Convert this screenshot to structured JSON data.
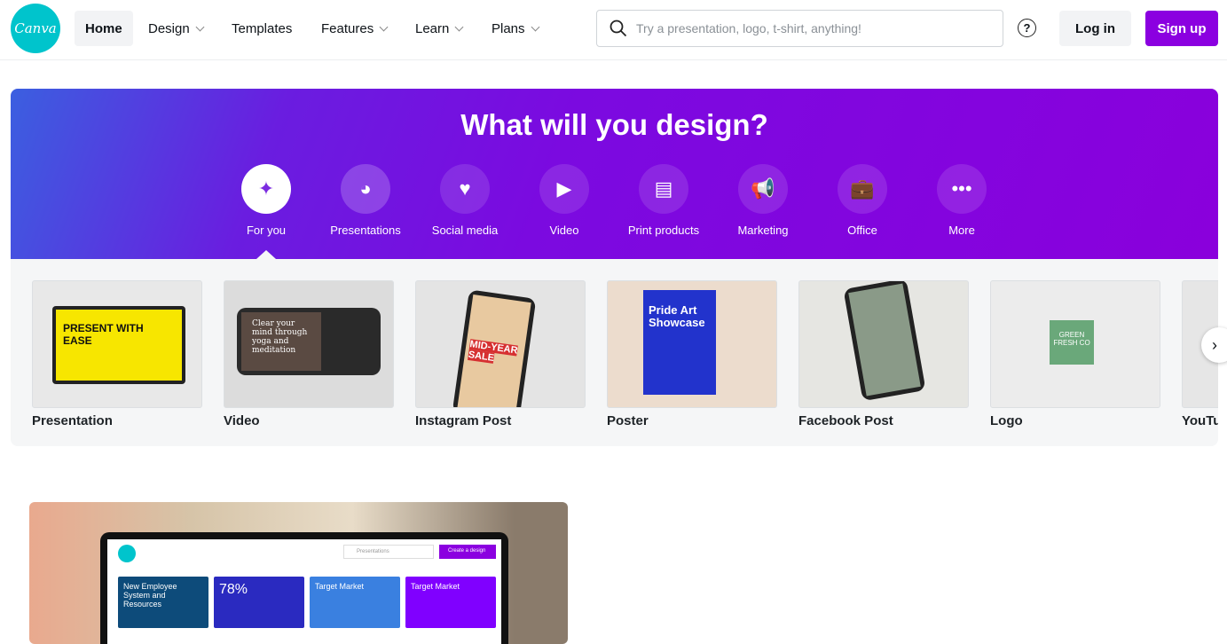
{
  "header": {
    "logo": "Canva",
    "nav": [
      {
        "label": "Home",
        "active": true
      },
      {
        "label": "Design",
        "dropdown": true
      },
      {
        "label": "Templates"
      },
      {
        "label": "Features",
        "dropdown": true
      },
      {
        "label": "Learn",
        "dropdown": true
      },
      {
        "label": "Plans",
        "dropdown": true
      }
    ],
    "search_placeholder": "Try a presentation, logo, t-shirt, anything!",
    "help": "?",
    "login": "Log in",
    "signup": "Sign up"
  },
  "colors": {
    "brand_teal": "#00c4cc",
    "accent_purple": "#8b00e0"
  },
  "banner": {
    "title": "What will you design?",
    "categories": [
      {
        "label": "For you",
        "icon": "sparkle-icon",
        "selected": true
      },
      {
        "label": "Presentations",
        "icon": "presentation-icon"
      },
      {
        "label": "Social media",
        "icon": "heart-bubble-icon"
      },
      {
        "label": "Video",
        "icon": "video-camera-icon"
      },
      {
        "label": "Print products",
        "icon": "printer-icon"
      },
      {
        "label": "Marketing",
        "icon": "megaphone-icon"
      },
      {
        "label": "Office",
        "icon": "briefcase-icon"
      },
      {
        "label": "More",
        "icon": "more-dots-icon"
      }
    ]
  },
  "designs": [
    {
      "label": "Presentation",
      "thumb": "PRESENT WITH EASE"
    },
    {
      "label": "Video",
      "thumb": "Clear your mind through yoga and meditation"
    },
    {
      "label": "Instagram Post",
      "thumb": "MID-YEAR SALE"
    },
    {
      "label": "Poster",
      "thumb": "Pride Art Showcase"
    },
    {
      "label": "Facebook Post",
      "thumb": ""
    },
    {
      "label": "Logo",
      "thumb": "GREEN FRESH CO"
    },
    {
      "label": "YouTube",
      "thumb": ""
    }
  ],
  "promo": {
    "search": "Presentations",
    "button": "Create a design",
    "stat": "78%",
    "tile1": "New Employee System and Resources",
    "tile3": "Target Market",
    "tile4": "Target Market"
  }
}
